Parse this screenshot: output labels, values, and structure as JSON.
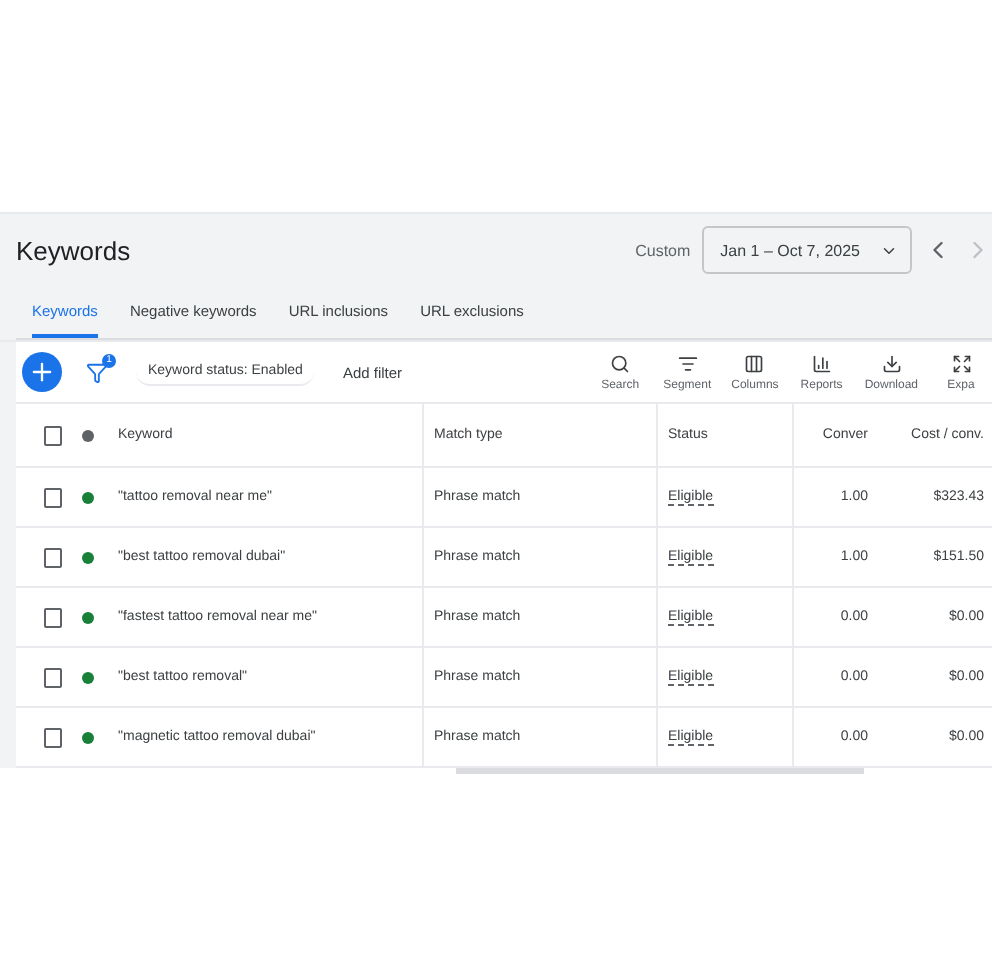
{
  "header": {
    "title": "Keywords",
    "date_label": "Custom",
    "date_range": "Jan 1 – Oct 7, 2025"
  },
  "tabs": [
    {
      "label": "Keywords",
      "selected": true
    },
    {
      "label": "Negative keywords",
      "selected": false
    },
    {
      "label": "URL inclusions",
      "selected": false
    },
    {
      "label": "URL exclusions",
      "selected": false
    }
  ],
  "toolbar": {
    "filter_count": "1",
    "filter_chip": "Keyword status: Enabled",
    "add_filter": "Add filter",
    "actions": [
      {
        "kind": "search",
        "label": "Search"
      },
      {
        "kind": "segment",
        "label": "Segment"
      },
      {
        "kind": "columns",
        "label": "Columns"
      },
      {
        "kind": "reports",
        "label": "Reports"
      },
      {
        "kind": "download",
        "label": "Download"
      },
      {
        "kind": "expand",
        "label": "Expa"
      }
    ]
  },
  "table": {
    "select_all_checked": false,
    "columns": [
      "Keyword",
      "Match type",
      "Status",
      "Conver",
      "Cost / conv."
    ],
    "rows": [
      {
        "checked": false,
        "color": "#188038",
        "keyword": "\"tattoo removal near me\"",
        "match_type": "Phrase match",
        "status": "Eligible",
        "conversions": "1.00",
        "cost_per_conv": "$323.43"
      },
      {
        "checked": false,
        "color": "#188038",
        "keyword": "\"best tattoo removal dubai\"",
        "match_type": "Phrase match",
        "status": "Eligible",
        "conversions": "1.00",
        "cost_per_conv": "$151.50"
      },
      {
        "checked": false,
        "color": "#188038",
        "keyword": "\"fastest tattoo removal near me\"",
        "match_type": "Phrase match",
        "status": "Eligible",
        "conversions": "0.00",
        "cost_per_conv": "$0.00"
      },
      {
        "checked": false,
        "color": "#188038",
        "keyword": "\"best tattoo removal\"",
        "match_type": "Phrase match",
        "status": "Eligible",
        "conversions": "0.00",
        "cost_per_conv": "$0.00"
      },
      {
        "checked": false,
        "color": "#188038",
        "keyword": "\"magnetic tattoo removal dubai\"",
        "match_type": "Phrase match",
        "status": "Eligible",
        "conversions": "0.00",
        "cost_per_conv": "$0.00"
      }
    ]
  }
}
